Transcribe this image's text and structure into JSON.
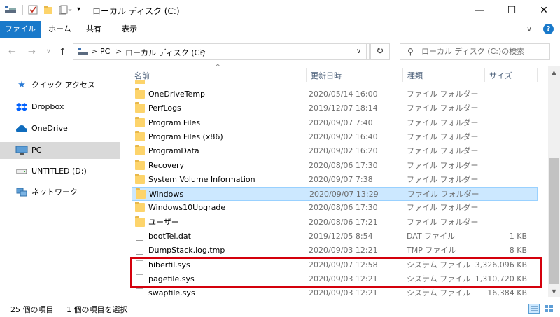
{
  "window": {
    "title": "ローカル ディスク (C:)",
    "minimize": "—",
    "maximize": "☐",
    "close": "✕"
  },
  "ribbon": {
    "tabs": [
      "ファイル",
      "ホーム",
      "共有",
      "表示"
    ],
    "help": "?",
    "collapse": "∨"
  },
  "address": {
    "back": "←",
    "forward": "→",
    "recent": "∨",
    "up": "↑",
    "separator": ">",
    "path": [
      "PC",
      "ローカル ディスク (C:)"
    ],
    "dropdown": "∨",
    "refresh": "↻",
    "search_placeholder": "ローカル ディスク (C:)の検索"
  },
  "nav_pane": {
    "items": [
      {
        "label": "クイック アクセス",
        "icon": "star-icon"
      },
      {
        "label": "Dropbox",
        "icon": "dropbox-icon"
      },
      {
        "label": "OneDrive",
        "icon": "cloud-icon"
      },
      {
        "label": "PC",
        "icon": "computer-icon",
        "selected": true
      },
      {
        "label": "UNTITLED (D:)",
        "icon": "drive-icon"
      },
      {
        "label": "ネットワーク",
        "icon": "network-icon"
      }
    ]
  },
  "columns": {
    "name": "名前",
    "date": "更新日時",
    "type": "種類",
    "size": "サイズ",
    "sort_indicator": "^"
  },
  "files": [
    {
      "name": "OneDriveTemp",
      "date": "2020/05/14 16:00",
      "type": "ファイル フォルダー",
      "size": "",
      "kind": "folder"
    },
    {
      "name": "PerfLogs",
      "date": "2019/12/07 18:14",
      "type": "ファイル フォルダー",
      "size": "",
      "kind": "folder"
    },
    {
      "name": "Program Files",
      "date": "2020/09/07 7:40",
      "type": "ファイル フォルダー",
      "size": "",
      "kind": "folder"
    },
    {
      "name": "Program Files (x86)",
      "date": "2020/09/02 16:40",
      "type": "ファイル フォルダー",
      "size": "",
      "kind": "folder"
    },
    {
      "name": "ProgramData",
      "date": "2020/09/02 16:20",
      "type": "ファイル フォルダー",
      "size": "",
      "kind": "folder"
    },
    {
      "name": "Recovery",
      "date": "2020/08/06 17:30",
      "type": "ファイル フォルダー",
      "size": "",
      "kind": "folder"
    },
    {
      "name": "System Volume Information",
      "date": "2020/09/07 7:38",
      "type": "ファイル フォルダー",
      "size": "",
      "kind": "folder"
    },
    {
      "name": "Windows",
      "date": "2020/09/07 13:29",
      "type": "ファイル フォルダー",
      "size": "",
      "kind": "folder",
      "selected": true
    },
    {
      "name": "Windows10Upgrade",
      "date": "2020/08/06 17:30",
      "type": "ファイル フォルダー",
      "size": "",
      "kind": "folder"
    },
    {
      "name": "ユーザー",
      "date": "2020/08/06 17:21",
      "type": "ファイル フォルダー",
      "size": "",
      "kind": "folder"
    },
    {
      "name": "bootTel.dat",
      "date": "2019/12/05 8:54",
      "type": "DAT ファイル",
      "size": "1 KB",
      "kind": "file"
    },
    {
      "name": "DumpStack.log.tmp",
      "date": "2020/09/03 12:21",
      "type": "TMP ファイル",
      "size": "8 KB",
      "kind": "file"
    },
    {
      "name": "hiberfil.sys",
      "date": "2020/09/07 12:58",
      "type": "システム ファイル",
      "size": "3,326,096 KB",
      "kind": "sys"
    },
    {
      "name": "pagefile.sys",
      "date": "2020/09/03 12:21",
      "type": "システム ファイル",
      "size": "1,310,720 KB",
      "kind": "sys"
    },
    {
      "name": "swapfile.sys",
      "date": "2020/09/03 12:21",
      "type": "システム ファイル",
      "size": "16,384 KB",
      "kind": "sys"
    }
  ],
  "status": {
    "item_count": "25 個の項目",
    "selected_count": "1 個の項目を選択"
  },
  "colors": {
    "accent": "#1979ca",
    "selection": "#cce8ff",
    "highlight": "#d4000c"
  }
}
